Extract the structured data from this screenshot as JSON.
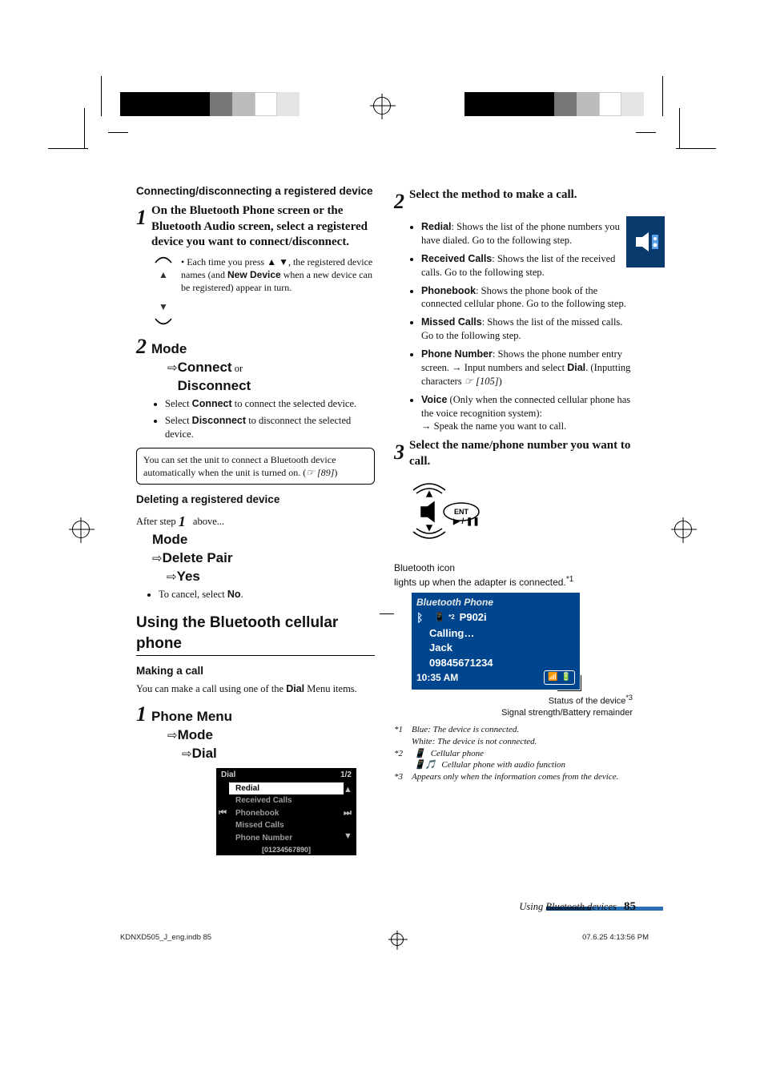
{
  "crop": {
    "colorbar_left": [
      "#000",
      "#0ff",
      "#f0f",
      "#ff0",
      "#000",
      "#777",
      "#fff",
      "#bbb"
    ],
    "colorbar_right": [
      "#000",
      "#0ff",
      "#f0f",
      "#ff0",
      "#000",
      "#777",
      "#fff",
      "#bbb"
    ]
  },
  "left": {
    "sec1_title": "Connecting/disconnecting a registered device",
    "s1_num": "1",
    "s1_text": "On the Bluetooth Phone screen or the Bluetooth Audio screen, select a registered device you want to connect/disconnect.",
    "s1_sub_a": "Each time you press ",
    "s1_sub_arrows": "▲ ▼",
    "s1_sub_b": ", the registered device names (and ",
    "s1_sub_new": "New Device",
    "s1_sub_c": " when a new device can be registered) appear in turn.",
    "s2_num": "2",
    "s2_mode": "Mode",
    "s2_connect": "Connect",
    "s2_or": " or",
    "s2_disconnect": "Disconnect",
    "s2_b1a": "Select ",
    "s2_b1b": "Connect",
    "s2_b1c": " to connect the selected device.",
    "s2_b2a": "Select ",
    "s2_b2b": "Disconnect",
    "s2_b2c": " to disconnect the selected device.",
    "note_a": "You can set the unit to connect a Bluetooth device automatically when the unit is turned on. (",
    "note_ref": "☞ [89]",
    "note_b": ")",
    "del_title": "Deleting a registered device",
    "del_after_a": "After step ",
    "del_after_num": "1",
    "del_after_b": " above...",
    "del_mode": "Mode",
    "del_pair": "Delete Pair",
    "del_yes": "Yes",
    "del_cancel_a": "To cancel, select ",
    "del_cancel_b": "No",
    "del_cancel_c": ".",
    "h2": "Using the Bluetooth cellular phone",
    "making_title": "Making a call",
    "making_intro_a": "You can make a call using one of the ",
    "making_intro_b": "Dial",
    "making_intro_c": " Menu items.",
    "phone_menu_num": "1",
    "phone_menu": "Phone Menu",
    "pm_mode": "Mode",
    "pm_dial": "Dial",
    "dial_hdr": "Dial",
    "dial_page": "1/2",
    "dial_items": [
      "Redial",
      "Received Calls",
      "Phonebook",
      "Missed Calls",
      "Phone Number"
    ],
    "dial_footer": "[01234567890]"
  },
  "right": {
    "s2_num": "2",
    "s2_text": "Select the method to make a call.",
    "defs": [
      {
        "t": "Redial",
        "d": ": Shows the list of the phone numbers you have dialed. Go to the following step."
      },
      {
        "t": "Received Calls",
        "d": ": Shows the list of the received calls. Go to the following step."
      },
      {
        "t": "Phonebook",
        "d": ": Shows the phone book of the connected cellular phone. Go to the following step."
      },
      {
        "t": "Missed Calls",
        "d": ": Shows the list of the missed calls. Go to the following step."
      },
      {
        "t": "Phone Number",
        "d_a": ": Shows the phone number entry screen. ",
        "arrow": "→",
        "d_b": " Input numbers and select ",
        "kw": "Dial",
        "d_c": ". (Inputting characters ",
        "ref": "☞ [105]",
        "d_d": ")"
      },
      {
        "t": "Voice",
        "paren": " (Only when the connected cellular phone has the voice recognition system): ",
        "arrow": "→",
        "d_e": " Speak the name you want to call."
      }
    ],
    "s3_num": "3",
    "s3_text": "Select the name/phone number you want to call.",
    "ent_label": "ENT",
    "play_pause": "▶ / ❚❚",
    "bt_icon_cap_a": "Bluetooth icon",
    "bt_icon_cap_b": "lights up when the adapter is connected.",
    "bt_icon_cap_b_sup": "*1",
    "bt_top": "Bluetooth Phone",
    "bt_dev_icon": "📱",
    "bt_dev_sup": "*2",
    "bt_dev": "P902i",
    "bt_status": "Calling…",
    "bt_name": "Jack",
    "bt_number": "09845671234",
    "bt_time": "10:35 AM",
    "bt_sig": "▮▮▯",
    "bt_bat": "▥",
    "right_note1_a": "Status of the device",
    "right_note1_sup": "*3",
    "right_note2": "Signal strength/Battery remainder",
    "fn1a": "*1",
    "fn1b_blue": "Blue: The device is connected.",
    "fn1b_white": "White: The device is not connected.",
    "fn2a": "*2",
    "fn2b": "Cellular phone",
    "fn2c": "Cellular phone with audio function",
    "fn3a": "*3",
    "fn3b": "Appears only when the information comes from the device."
  },
  "footer": {
    "section": "Using Bluetooth devices",
    "page": "85",
    "file": "KDNXD505_J_eng.indb   85",
    "date": "07.6.25   4:13:56 PM"
  }
}
